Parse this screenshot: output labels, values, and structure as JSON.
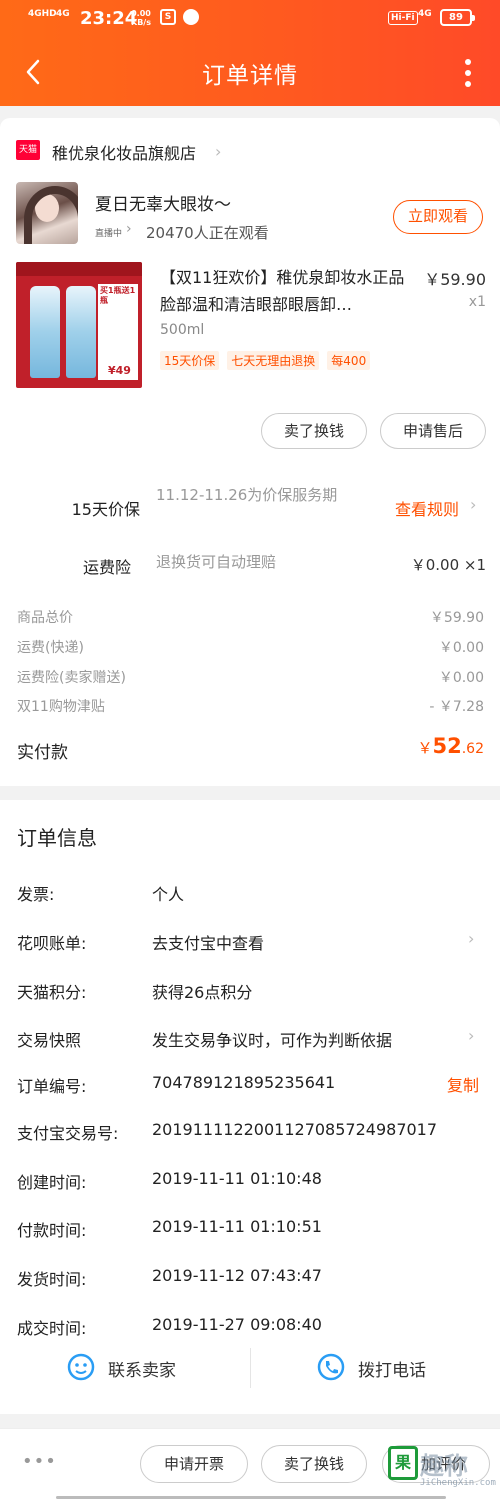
{
  "status_bar": {
    "signal1": "4GHD",
    "signal2": "4G",
    "time": "23:24",
    "speed_value": "0.00",
    "speed_unit": "KB/s",
    "hifi": "Hi-Fi",
    "network": "4G",
    "battery": "89"
  },
  "header": {
    "title": "订单详情"
  },
  "shop": {
    "logo_text": "天猫",
    "name": "稚优泉化妆品旗舰店"
  },
  "live": {
    "title": "夏日无辜大眼妆～",
    "tag": "直播中",
    "viewers": "20470人正在观看",
    "watch_button": "立即观看"
  },
  "product": {
    "image_promo": "买1瓶送1瓶",
    "image_price": "¥49",
    "title": "【双11狂欢价】稚优泉卸妆水正品脸部温和清洁眼部眼唇卸…",
    "price": "￥59.90",
    "quantity": "x1",
    "spec": "500ml",
    "tags": [
      "15天价保",
      "七天无理由退换",
      "每400"
    ]
  },
  "actions": {
    "sell": "卖了换钱",
    "after_sale": "申请售后"
  },
  "price_protect": {
    "label": "15天价保",
    "text": "11.12-11.26为价保服务期",
    "link": "查看规则"
  },
  "shipping_insurance": {
    "label": "运费险",
    "text": "退换货可自动理赔",
    "value": "￥0.00 ×1"
  },
  "fees": [
    {
      "label": "商品总价",
      "value": "￥59.90"
    },
    {
      "label": "运费(快递)",
      "value": "￥0.00"
    },
    {
      "label": "运费险(卖家赠送)",
      "value": "￥0.00"
    },
    {
      "label": "双11购物津贴",
      "value": "- ￥7.28"
    }
  ],
  "paid": {
    "label": "实付款",
    "currency": "￥",
    "integer": "52",
    "decimal": ".62"
  },
  "order_info": {
    "title": "订单信息",
    "rows": [
      {
        "label": "发票:",
        "value": "个人"
      },
      {
        "label": "花呗账单:",
        "value": "去支付宝中查看"
      },
      {
        "label": "天猫积分:",
        "value": "获得26点积分"
      },
      {
        "label": "交易快照",
        "value": "发生交易争议时，可作为判断依据"
      },
      {
        "label": "订单编号:",
        "value": "704789121895235641"
      },
      {
        "label": "支付宝交易号:",
        "value": "2019111122001127085724987017"
      },
      {
        "label": "创建时间:",
        "value": "2019-11-11 01:10:48"
      },
      {
        "label": "付款时间:",
        "value": "2019-11-11 01:10:51"
      },
      {
        "label": "发货时间:",
        "value": "2019-11-12 07:43:47"
      },
      {
        "label": "成交时间:",
        "value": "2019-11-27 09:08:40"
      }
    ],
    "copy_label": "复制"
  },
  "contact": {
    "seller": "联系卖家",
    "phone": "拨打电话"
  },
  "bottom_bar": {
    "more": "•••",
    "invoice": "申请开票",
    "sell": "卖了换钱",
    "review": "加评价"
  },
  "watermark": {
    "icon_text": "果",
    "text": "趣称",
    "url": "JiChengXin.com"
  }
}
